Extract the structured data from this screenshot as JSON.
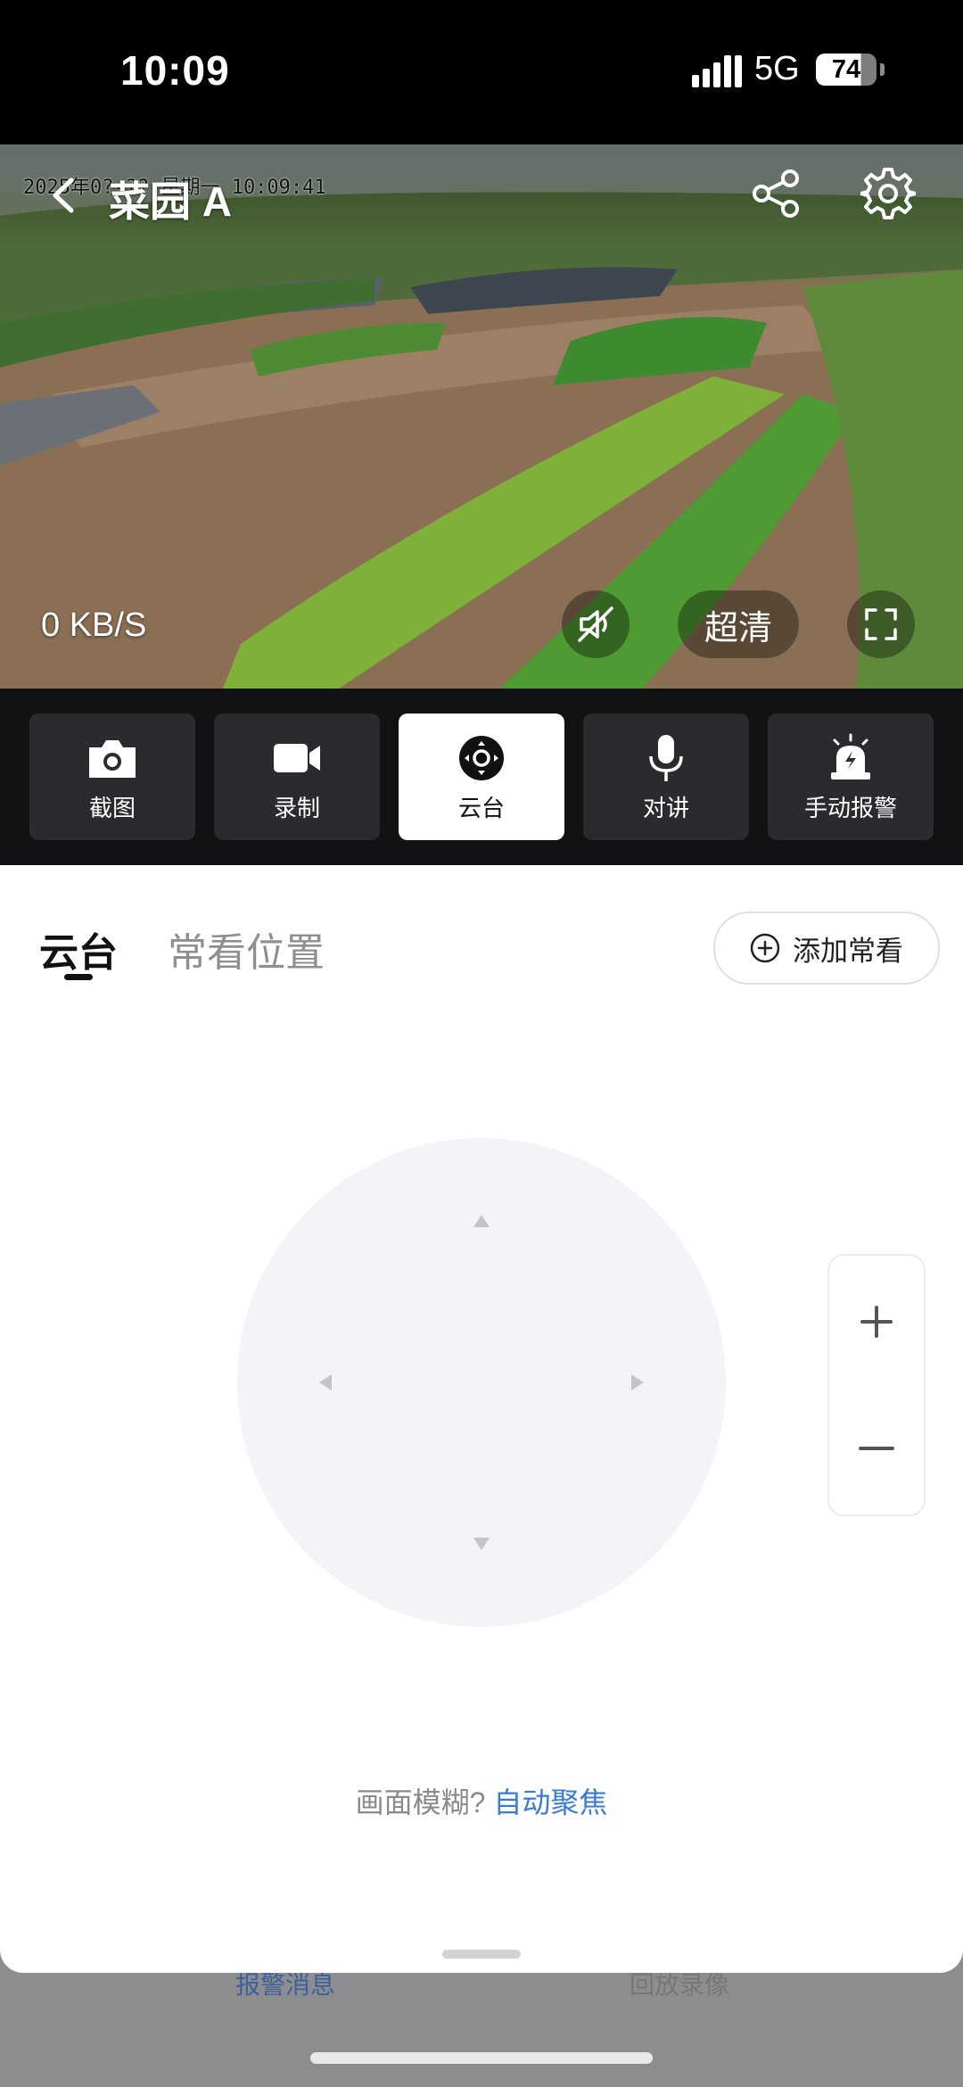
{
  "status_bar": {
    "time": "10:09",
    "network": "5G",
    "battery": "74"
  },
  "video": {
    "osd_timestamp": "2025年0?-?? 星期一 10:09:41",
    "title": "菜园 A",
    "speed": "0 KB/S",
    "quality": "超清"
  },
  "toolbar": [
    {
      "label": "截图",
      "icon": "camera-icon"
    },
    {
      "label": "录制",
      "icon": "video-record-icon"
    },
    {
      "label": "云台",
      "icon": "ptz-icon",
      "active": true
    },
    {
      "label": "对讲",
      "icon": "microphone-icon"
    },
    {
      "label": "手动报警",
      "icon": "alarm-icon"
    }
  ],
  "tabs": {
    "ptz": "云台",
    "favorites": "常看位置"
  },
  "add_favorite": "添加常看",
  "focus": {
    "prompt": "画面模糊?",
    "action": "自动聚焦"
  },
  "bottom_tabs": {
    "left": "报警消息",
    "right": "回放录像"
  },
  "colors": {
    "link": "#3a7bd5",
    "active_tab": "#111111",
    "toolbar_bg": "#111214"
  }
}
